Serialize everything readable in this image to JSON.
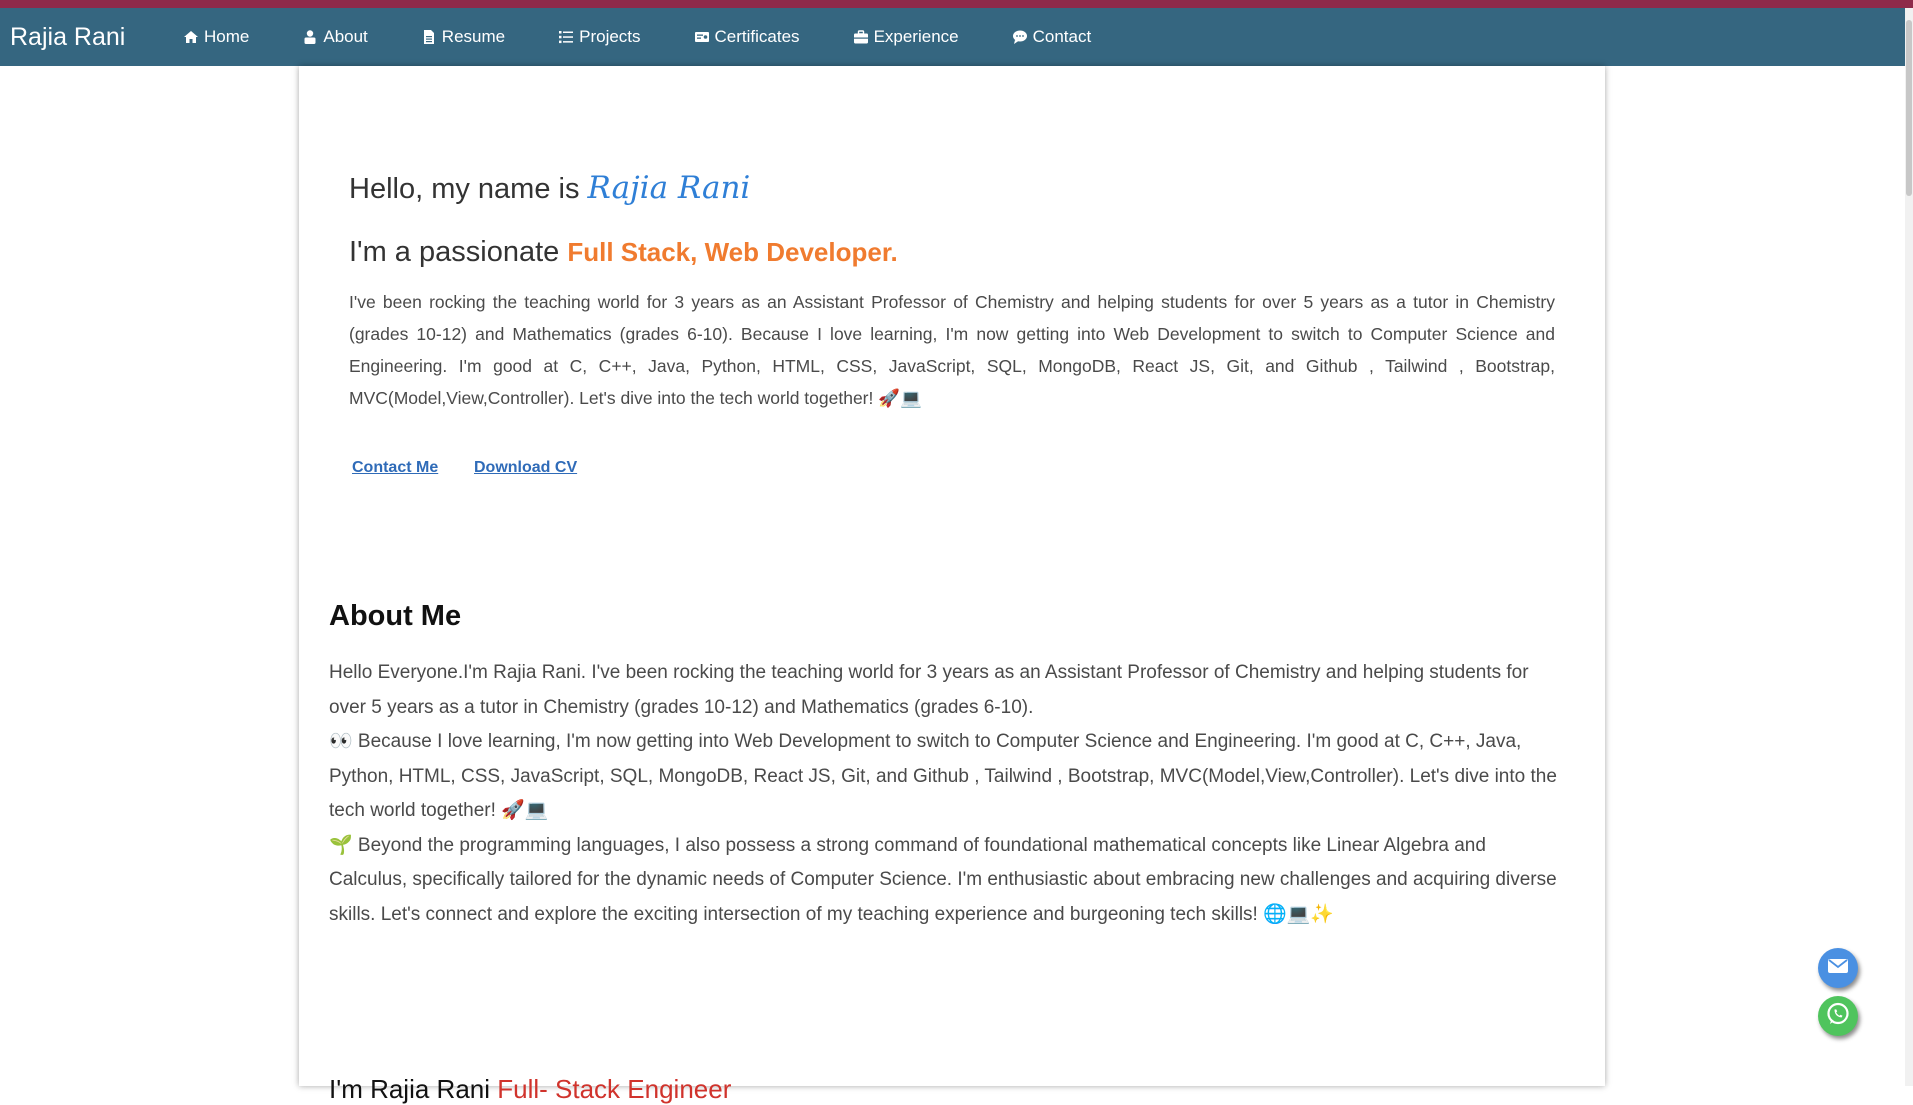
{
  "brand": "Rajia Rani",
  "nav": {
    "items": [
      {
        "label": "Home",
        "icon": "home-icon"
      },
      {
        "label": "About",
        "icon": "user-icon"
      },
      {
        "label": "Resume",
        "icon": "document-icon"
      },
      {
        "label": "Projects",
        "icon": "list-icon"
      },
      {
        "label": "Certificates",
        "icon": "certificate-icon"
      },
      {
        "label": "Experience",
        "icon": "briefcase-icon"
      },
      {
        "label": "Contact",
        "icon": "chat-icon"
      }
    ]
  },
  "hero": {
    "greeting": "Hello, my name is ",
    "name": "Rajia Rani",
    "passion_prefix": "I'm a passionate ",
    "role": "Full Stack, Web Developer.",
    "intro": "I've been rocking the teaching world for 3 years as an Assistant Professor of Chemistry and helping students for over 5 years as a tutor in Chemistry (grades 10-12) and Mathematics (grades 6-10). Because I love learning, I'm now getting into Web Development to switch to Computer Science and Engineering. I'm good at C, C++, Java, Python, HTML, CSS, JavaScript, SQL, MongoDB, React JS, Git, and Github , Tailwind , Bootstrap, MVC(Model,View,Controller). Let's dive into the tech world together! 🚀💻",
    "contact_label": "Contact Me",
    "download_label": "Download CV"
  },
  "about": {
    "heading": "About Me",
    "p1": "Hello Everyone.I'm Rajia Rani. I've been rocking the teaching world for 3 years as an Assistant Professor of Chemistry and helping students for over 5 years as a tutor in Chemistry (grades 10-12) and Mathematics (grades 6-10).",
    "p2": "👀 Because I love learning, I'm now getting into Web Development to switch to Computer Science and Engineering. I'm good at C, C++, Java, Python, HTML, CSS, JavaScript, SQL, MongoDB, React JS, Git, and Github , Tailwind , Bootstrap, MVC(Model,View,Controller). Let's dive into the tech world together! 🚀💻",
    "p3": "🌱 Beyond the programming languages, I also possess a strong command of foundational mathematical concepts like Linear Algebra and Calculus, specifically tailored for the dynamic needs of Computer Science. I'm enthusiastic about embracing new challenges and acquiring diverse skills. Let's connect and explore the exciting intersection of my teaching experience and burgeoning tech skills! 🌐💻✨"
  },
  "tagline": {
    "prefix": "I'm Rajia Rani ",
    "role": "Full- Stack Engineer"
  },
  "floating": {
    "mail_icon": "mail-icon",
    "whatsapp_icon": "whatsapp-icon"
  },
  "colors": {
    "navbar": "#356680",
    "top_stripe": "#8e2a4a",
    "name_accent": "#2f7fd6",
    "role_accent": "#f07b2f",
    "tagline_accent": "#d0332c"
  }
}
